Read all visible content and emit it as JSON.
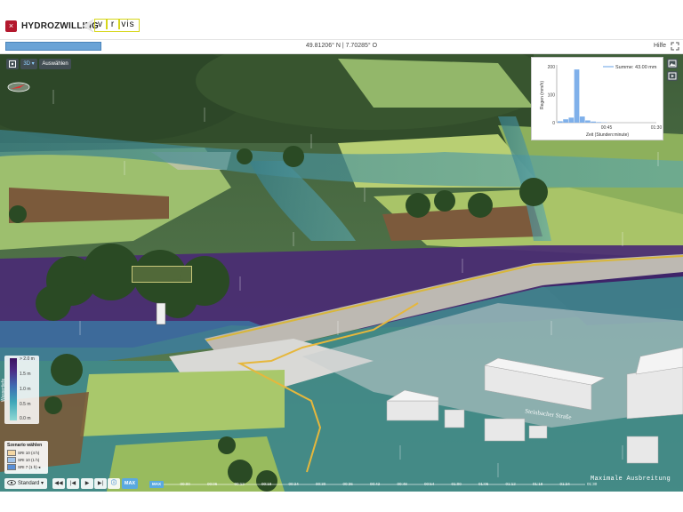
{
  "app": {
    "title": "HYDROZWILLING",
    "close_label": "×",
    "logo_letters": [
      "v",
      "r",
      "vis"
    ]
  },
  "status": {
    "progress_fraction": 1.0,
    "coordinates": "49.81206° N | 7.70285° O",
    "help_label": "Hilfe"
  },
  "toolbar": {
    "mode_label": "3D",
    "select_label": "Auswählen"
  },
  "chart_data": {
    "type": "bar",
    "xlabel": "Zeit (Stunden:minute)",
    "ylabel": "Regen (mm/h)",
    "legend": "Summe: 43.00 mm",
    "legend_position": "top-right",
    "yticks": [
      "0",
      "100",
      "200"
    ],
    "ylim": [
      0,
      200
    ],
    "xticks": [
      "00:45",
      "01:30"
    ],
    "x_minutes": [
      0,
      5,
      10,
      15,
      20,
      25,
      30,
      35,
      40
    ],
    "values": [
      5,
      12,
      18,
      190,
      22,
      8,
      4,
      2,
      1
    ],
    "color": "#7fb0ea"
  },
  "legend": {
    "title": "Wassertiefe",
    "ticks": [
      "> 2.0 m",
      "1.5 m",
      "1.0 m",
      "0.5 m",
      "0.0 m"
    ],
    "colors": [
      "#3b1160",
      "#3e6cb2",
      "#3fa7b8",
      "#8ed8d4"
    ]
  },
  "scenario": {
    "title": "Szenario wählen",
    "items": [
      {
        "label": "SRI 10 (4 h)",
        "color": "#f5d7a3"
      },
      {
        "label": "SRI 10 (1 h)",
        "color": "#9fc2ea"
      },
      {
        "label": "SRI 7 (1 h)",
        "color": "#5a8fd6"
      }
    ]
  },
  "playback": {
    "view_label": "Standard",
    "max_label": "MAX",
    "timeline_labels": [
      "MAX",
      "00:00",
      "00:06",
      "00:12",
      "00:18",
      "00:24",
      "00:30",
      "00:36",
      "00:42",
      "00:48",
      "00:54",
      "01:00",
      "01:06",
      "01:12",
      "01:18",
      "01:24",
      "01:30"
    ]
  },
  "scene": {
    "street_name": "Steinbacher Straße",
    "mode_caption": "Maximale Ausbreitung"
  }
}
